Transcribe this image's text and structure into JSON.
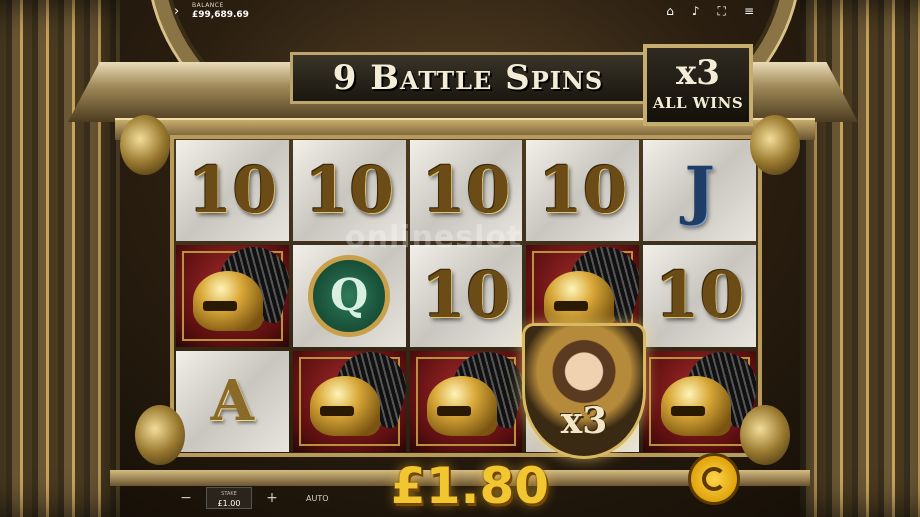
{
  "header": {
    "balance_label": "BALANCE",
    "balance_value": "£99,689.69",
    "menu_icon": "chevron-right-icon",
    "icons": [
      "home-icon",
      "volume-icon",
      "fullscreen-icon",
      "hamburger-menu-icon"
    ]
  },
  "feature": {
    "title": "9 Battle Spins",
    "multiplier": "x3",
    "multiplier_label": "ALL WINS"
  },
  "reels": [
    [
      "10",
      "helmet",
      "A"
    ],
    [
      "10",
      "Q",
      "helmet"
    ],
    [
      "10",
      "10",
      "helmet"
    ],
    [
      "10",
      "helmet",
      "wild"
    ],
    [
      "J",
      "10",
      "helmet"
    ]
  ],
  "wild": {
    "multiplier": "x3"
  },
  "watermark": "onlineslot",
  "win_amount": "£1.80",
  "controls": {
    "minus": "−",
    "plus": "+",
    "stake_label": "STAKE",
    "stake_value": "£1.00",
    "auto_label": "AUTO",
    "spin_icon": "spin-icon"
  },
  "colors": {
    "gold": "#f2c631",
    "red_panel": "#8c1d1e",
    "emerald": "#2f7b58",
    "jack_blue": "#1e3e68"
  }
}
